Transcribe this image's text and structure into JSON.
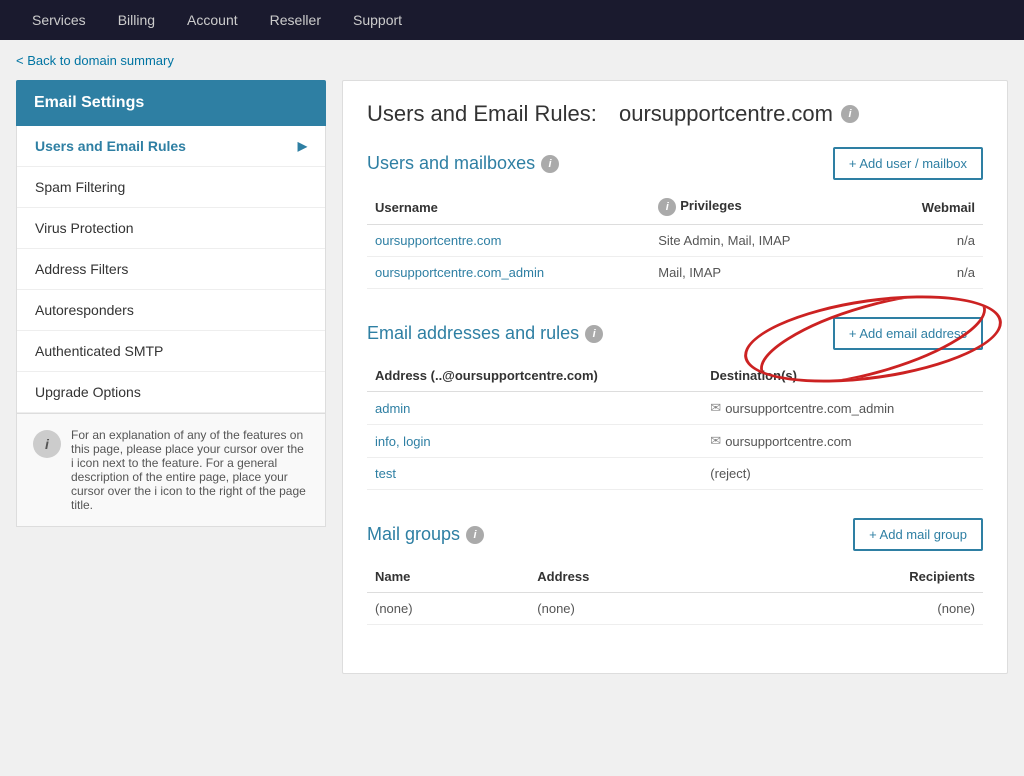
{
  "nav": {
    "items": [
      {
        "label": "Services",
        "href": "#"
      },
      {
        "label": "Billing",
        "href": "#"
      },
      {
        "label": "Account",
        "href": "#"
      },
      {
        "label": "Reseller",
        "href": "#"
      },
      {
        "label": "Support",
        "href": "#"
      }
    ]
  },
  "back_link": "< Back to domain summary",
  "sidebar": {
    "title": "Email Settings",
    "items": [
      {
        "label": "Users and Email Rules",
        "active": true,
        "has_arrow": true
      },
      {
        "label": "Spam Filtering",
        "active": false,
        "has_arrow": false
      },
      {
        "label": "Virus Protection",
        "active": false,
        "has_arrow": false
      },
      {
        "label": "Address Filters",
        "active": false,
        "has_arrow": false
      },
      {
        "label": "Autoresponders",
        "active": false,
        "has_arrow": false
      },
      {
        "label": "Authenticated SMTP",
        "active": false,
        "has_arrow": false
      },
      {
        "label": "Upgrade Options",
        "active": false,
        "has_arrow": false
      }
    ],
    "info_text": "For an explanation of any of the features on this page, please place your cursor over the i icon next to the feature. For a general description of the entire page, place your cursor over the i icon to the right of the page title."
  },
  "page_title": {
    "prefix": "Users and Email Rules:",
    "domain": "oursupportcentre.com"
  },
  "users_mailboxes": {
    "section_title": "Users and mailboxes",
    "add_button": "+ Add user / mailbox",
    "columns": {
      "username": "Username",
      "privileges": "Privileges",
      "webmail": "Webmail"
    },
    "rows": [
      {
        "username": "oursupportcentre.com",
        "privileges": "Site Admin, Mail, IMAP",
        "webmail": "n/a"
      },
      {
        "username": "oursupportcentre.com_admin",
        "privileges": "Mail, IMAP",
        "webmail": "n/a"
      }
    ]
  },
  "email_rules": {
    "section_title": "Email addresses and rules",
    "add_button": "+ Add email address",
    "columns": {
      "address": "Address (..@oursupportcentre.com)",
      "destination": "Destination(s)"
    },
    "rows": [
      {
        "address": "admin",
        "destination": "oursupportcentre.com_admin",
        "has_icon": true
      },
      {
        "address": "info, login",
        "destination": "oursupportcentre.com",
        "has_icon": true
      },
      {
        "address": "test",
        "destination": "(reject)",
        "has_icon": false
      }
    ]
  },
  "mail_groups": {
    "section_title": "Mail groups",
    "add_button": "+ Add mail group",
    "columns": {
      "name": "Name",
      "address": "Address",
      "recipients": "Recipients"
    },
    "rows": [
      {
        "name": "(none)",
        "address": "(none)",
        "recipients": "(none)"
      }
    ]
  }
}
